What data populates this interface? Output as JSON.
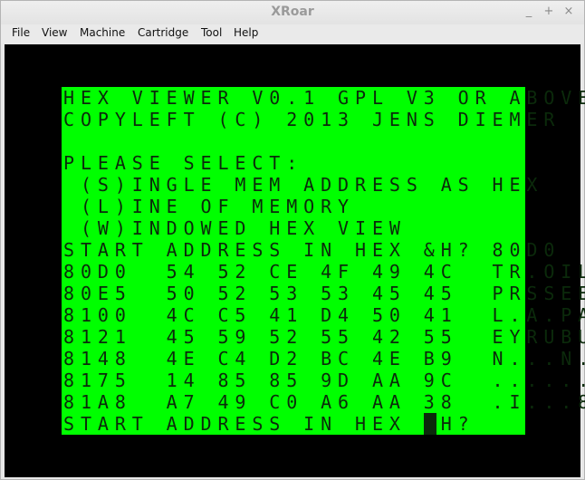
{
  "window": {
    "title": "XRoar",
    "minimize_glyph": "_",
    "maximize_glyph": "+",
    "close_glyph": "×"
  },
  "menu": {
    "items": [
      "File",
      "View",
      "Machine",
      "Cartridge",
      "Tool",
      "Help"
    ]
  },
  "screen": {
    "lines": [
      "HEX VIEWER V0.1 GPL V3 OR ABOVE",
      "COPYLEFT (C) 2013 JENS DIEMER",
      "",
      "PLEASE SELECT:",
      " (S)INGLE MEM ADDRESS AS HEX",
      " (L)INE OF MEMORY",
      " (W)INDOWED HEX VIEW",
      "START ADDRESS IN HEX &H? 80D0",
      "80D0  54 52 CE 4F 49 4C  TR.OIL",
      "80E5  50 52 53 53 45 45  PRSSEE",
      "8100  4C C5 41 D4 50 41  L.A.PA",
      "8121  45 59 52 55 42 55  EYRUBU",
      "8148  4E C4 D2 BC 4E B9  N...N.",
      "8175  14 85 85 9D AA 9C  ......",
      "81A8  A7 49 C0 A6 AA 38  .I...8",
      "START ADDRESS IN HEX &H? "
    ]
  },
  "colors": {
    "screen_bg": "#00ff00",
    "text": "#0b2a0b",
    "border": "#000000"
  }
}
